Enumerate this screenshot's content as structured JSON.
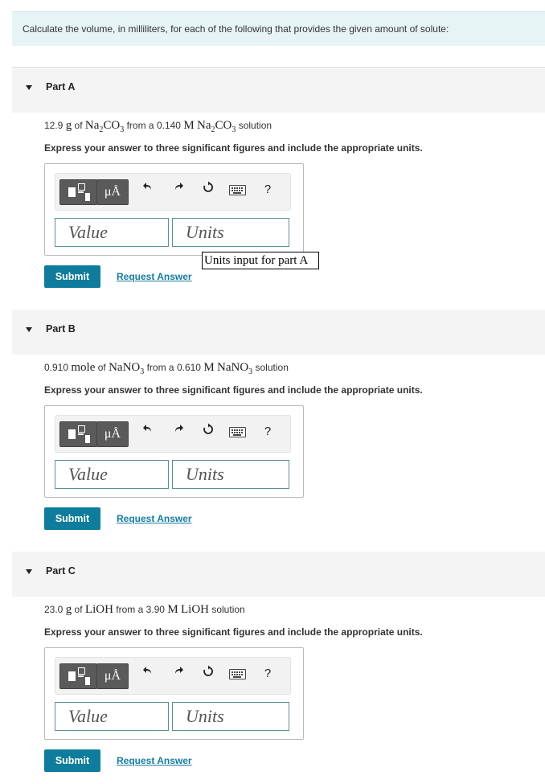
{
  "instructions": "Calculate the volume, in milliliters, for each of the following that provides the given amount of solute:",
  "toolbar": {
    "units_button": "μÅ",
    "help_label": "?"
  },
  "parts": [
    {
      "label": "Part A",
      "amount": "12.9",
      "amount_unit": "g",
      "solute_html": "Na<sub>2</sub>CO<sub>3</sub>",
      "conc": "0.140",
      "express": "Express your answer to three significant figures and include the appropriate units.",
      "value_placeholder": "Value",
      "units_placeholder": "Units",
      "submit": "Submit",
      "request_answer": "Request Answer"
    },
    {
      "label": "Part B",
      "amount": "0.910",
      "amount_unit": "mole",
      "solute_html": "NaNO<sub>3</sub>",
      "conc": "0.610",
      "express": "Express your answer to three significant figures and include the appropriate units.",
      "value_placeholder": "Value",
      "units_placeholder": "Units",
      "submit": "Submit",
      "request_answer": "Request Answer"
    },
    {
      "label": "Part C",
      "amount": "23.0",
      "amount_unit": "g",
      "solute_html": "LiOH",
      "conc": "3.90",
      "express": "Express your answer to three significant figures and include the appropriate units.",
      "value_placeholder": "Value",
      "units_placeholder": "Units",
      "submit": "Submit",
      "request_answer": "Request Answer"
    }
  ],
  "prompt_words": {
    "of": "of",
    "from_a": "from a",
    "molar": "M",
    "solution": "solution"
  },
  "tooltip": "Units input for part A"
}
